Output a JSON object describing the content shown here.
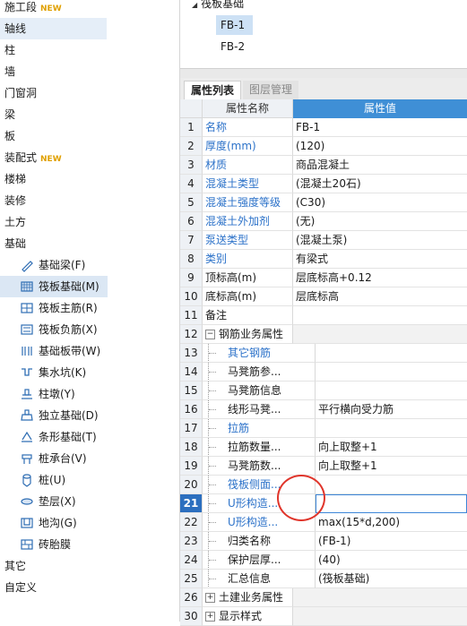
{
  "sidebar": {
    "top_items": [
      {
        "label": "施工段",
        "badge": "NEW"
      },
      {
        "label": "轴线",
        "active": true
      },
      {
        "label": "柱"
      },
      {
        "label": "墙"
      },
      {
        "label": "门窗洞"
      },
      {
        "label": "梁"
      },
      {
        "label": "板"
      },
      {
        "label": "装配式",
        "badge": "NEW"
      },
      {
        "label": "楼梯"
      },
      {
        "label": "装修"
      },
      {
        "label": "土方"
      },
      {
        "label": "基础"
      }
    ],
    "sub_items": [
      {
        "label": "基础梁(F)",
        "icon": "foundation-beam-icon"
      },
      {
        "label": "筏板基础(M)",
        "icon": "raft-foundation-icon",
        "active": true
      },
      {
        "label": "筏板主筋(R)",
        "icon": "raft-main-rebar-icon"
      },
      {
        "label": "筏板负筋(X)",
        "icon": "raft-negative-rebar-icon"
      },
      {
        "label": "基础板带(W)",
        "icon": "foundation-strip-icon"
      },
      {
        "label": "集水坑(K)",
        "icon": "sump-pit-icon"
      },
      {
        "label": "柱墩(Y)",
        "icon": "column-pier-icon"
      },
      {
        "label": "独立基础(D)",
        "icon": "isolated-footing-icon"
      },
      {
        "label": "条形基础(T)",
        "icon": "strip-footing-icon"
      },
      {
        "label": "桩承台(V)",
        "icon": "pile-cap-icon"
      },
      {
        "label": "桩(U)",
        "icon": "pile-icon"
      },
      {
        "label": "垫层(X)",
        "icon": "cushion-layer-icon"
      },
      {
        "label": "地沟(G)",
        "icon": "trench-icon"
      },
      {
        "label": "砖胎膜",
        "icon": "brick-mold-icon"
      }
    ],
    "bottom_items": [
      {
        "label": "其它"
      },
      {
        "label": "自定义"
      }
    ]
  },
  "tree": {
    "root": "筏板基础",
    "items": [
      "FB-1",
      "FB-2"
    ],
    "selected": "FB-1"
  },
  "tabs": [
    {
      "label": "属性列表",
      "active": true
    },
    {
      "label": "图层管理",
      "active": false
    }
  ],
  "table": {
    "headers": {
      "name": "属性名称",
      "value": "属性值"
    },
    "rows": [
      {
        "no": "1",
        "name": "名称",
        "value": "FB-1",
        "blue": true
      },
      {
        "no": "2",
        "name": "厚度(mm)",
        "value": "(120)",
        "blue": true
      },
      {
        "no": "3",
        "name": "材质",
        "value": "商品混凝土",
        "blue": true
      },
      {
        "no": "4",
        "name": "混凝土类型",
        "value": "(混凝土20石)",
        "blue": true
      },
      {
        "no": "5",
        "name": "混凝土强度等级",
        "value": "(C30)",
        "blue": true
      },
      {
        "no": "6",
        "name": "混凝土外加剂",
        "value": "(无)",
        "blue": true
      },
      {
        "no": "7",
        "name": "泵送类型",
        "value": "(混凝土泵)",
        "blue": true
      },
      {
        "no": "8",
        "name": "类别",
        "value": "有梁式",
        "blue": true
      },
      {
        "no": "9",
        "name": "顶标高(m)",
        "value": "层底标高+0.12"
      },
      {
        "no": "10",
        "name": "底标高(m)",
        "value": "层底标高"
      },
      {
        "no": "11",
        "name": "备注",
        "value": ""
      },
      {
        "no": "12",
        "name": "钢筋业务属性",
        "value": "",
        "group": true,
        "expander": "−"
      },
      {
        "no": "13",
        "name": "其它钢筋",
        "value": "",
        "blue": true,
        "child": true
      },
      {
        "no": "14",
        "name": "马凳筋参...",
        "value": "",
        "child": true
      },
      {
        "no": "15",
        "name": "马凳筋信息",
        "value": "",
        "child": true
      },
      {
        "no": "16",
        "name": "线形马凳...",
        "value": "平行横向受力筋",
        "child": true
      },
      {
        "no": "17",
        "name": "拉筋",
        "value": "",
        "blue": true,
        "child": true
      },
      {
        "no": "18",
        "name": "拉筋数量...",
        "value": "向上取整+1",
        "child": true
      },
      {
        "no": "19",
        "name": "马凳筋数...",
        "value": "向上取整+1",
        "child": true
      },
      {
        "no": "20",
        "name": "筏板侧面...",
        "value": "",
        "blue": true,
        "child": true
      },
      {
        "no": "21",
        "name": "U形构造...",
        "value": "",
        "blue": true,
        "child": true,
        "active": true
      },
      {
        "no": "22",
        "name": "U形构造...",
        "value": "max(15*d,200)",
        "blue": true,
        "child": true
      },
      {
        "no": "23",
        "name": "归类名称",
        "value": "(FB-1)",
        "child": true
      },
      {
        "no": "24",
        "name": "保护层厚...",
        "value": "(40)",
        "child": true
      },
      {
        "no": "25",
        "name": "汇总信息",
        "value": "(筏板基础)",
        "child": true
      },
      {
        "no": "26",
        "name": "土建业务属性",
        "value": "",
        "group": true,
        "expander": "+"
      },
      {
        "no": "30",
        "name": "显示样式",
        "value": "",
        "group": true,
        "expander": "+"
      }
    ]
  },
  "colors": {
    "accent": "#3f8fd6",
    "selected_row": "#2c6fbf",
    "link": "#2c72c9",
    "highlight_circle": "#e0352b"
  }
}
